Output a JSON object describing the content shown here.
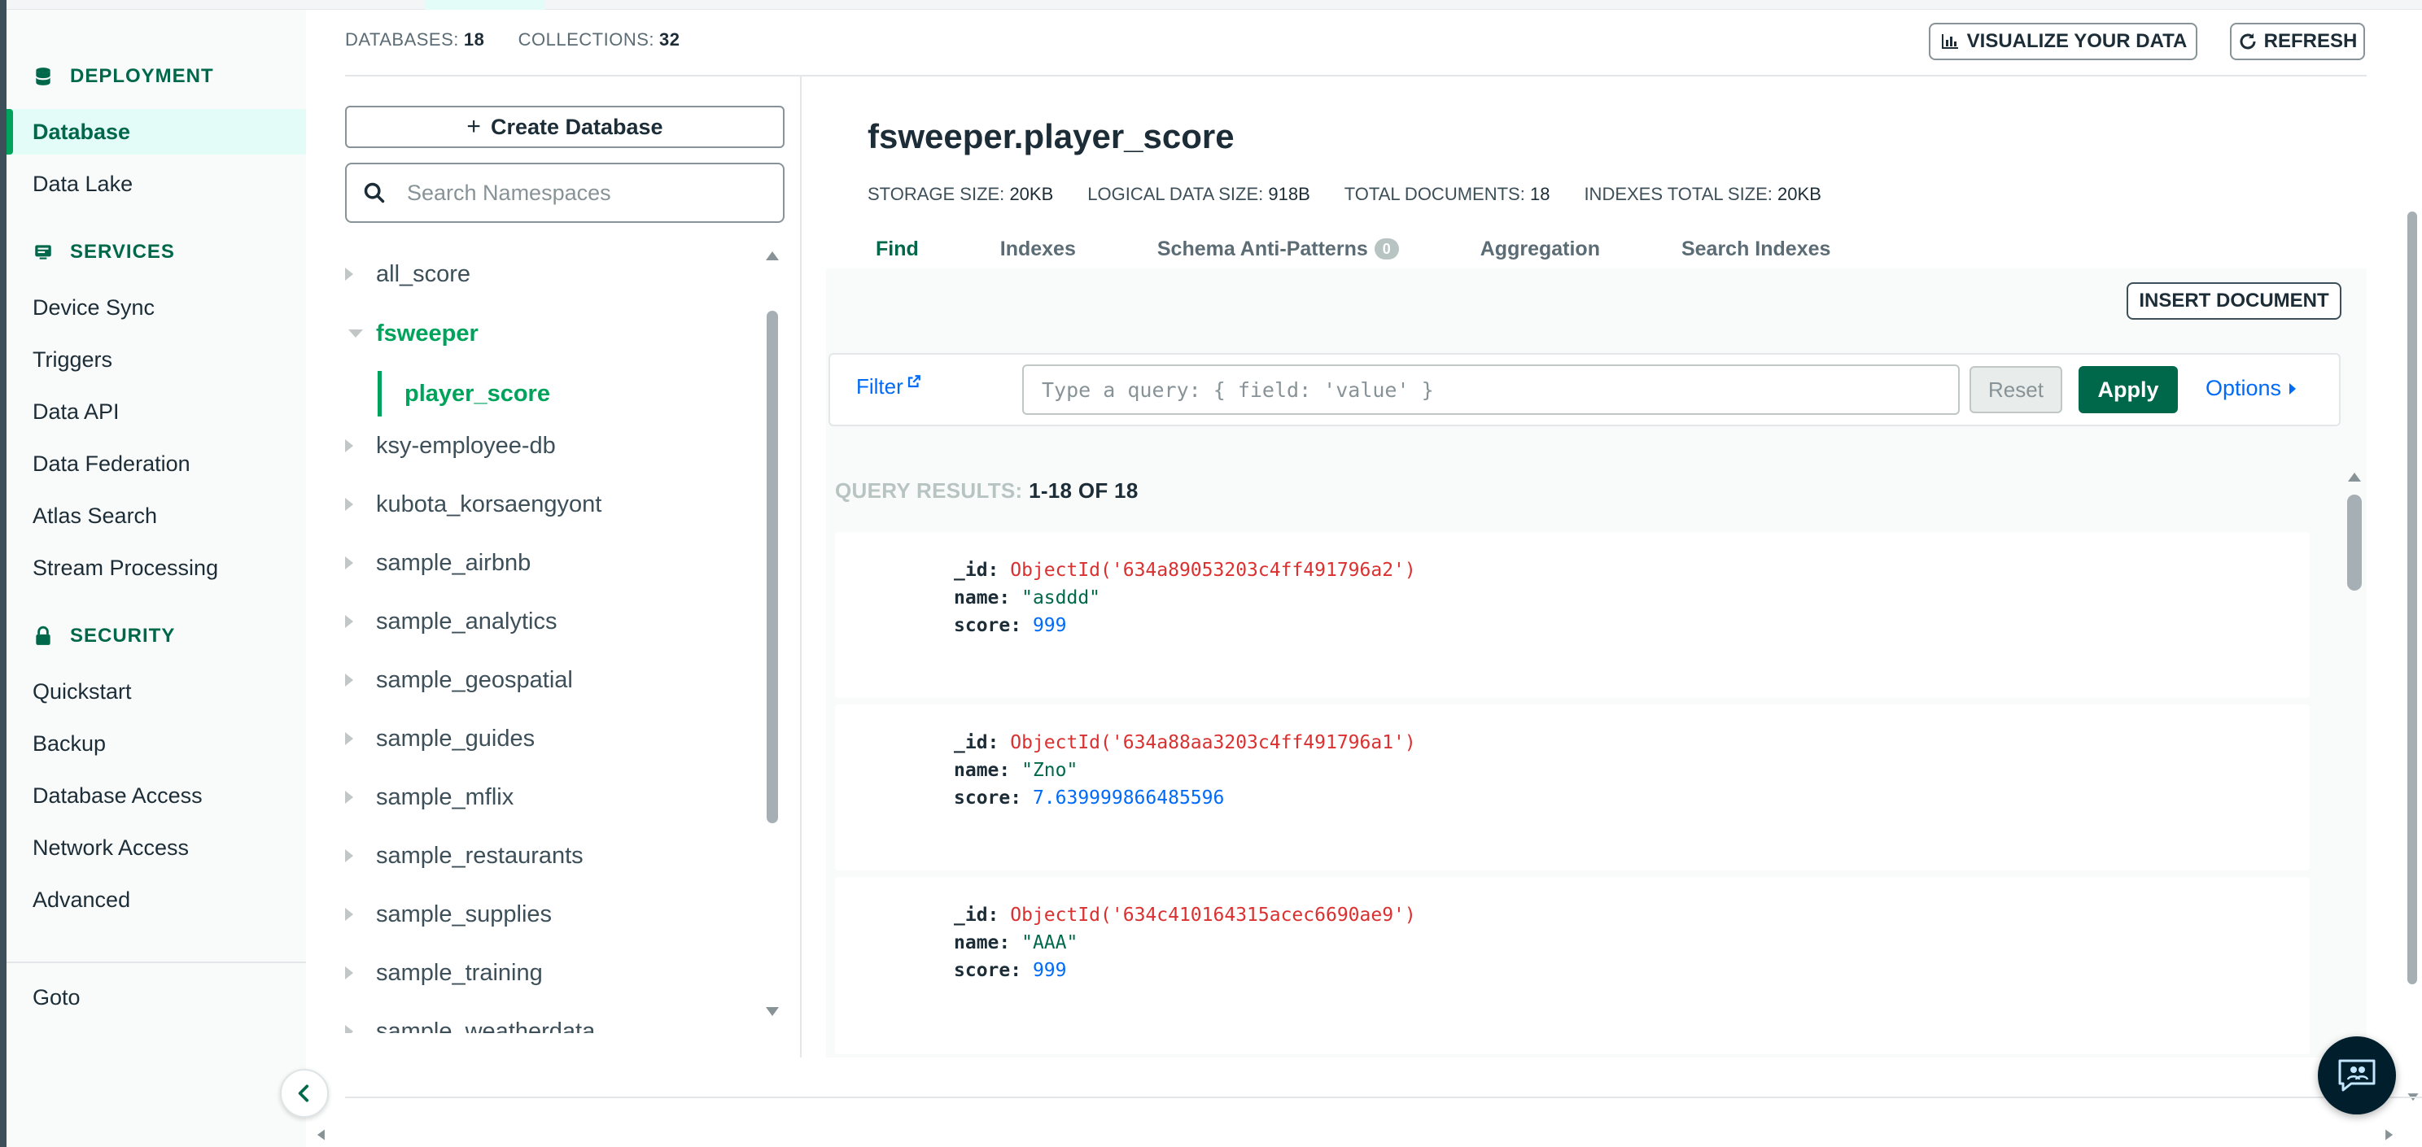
{
  "header": {
    "databases_label": "DATABASES:",
    "databases_count": "18",
    "collections_label": "COLLECTIONS:",
    "collections_count": "32",
    "visualize_label": "VISUALIZE YOUR DATA",
    "refresh_label": "REFRESH"
  },
  "sidebar": {
    "sections": [
      {
        "title": "DEPLOYMENT",
        "icon": "database-icon",
        "items": [
          "Database",
          "Data Lake"
        ]
      },
      {
        "title": "SERVICES",
        "icon": "services-icon",
        "items": [
          "Device Sync",
          "Triggers",
          "Data API",
          "Data Federation",
          "Atlas Search",
          "Stream Processing"
        ]
      },
      {
        "title": "SECURITY",
        "icon": "lock-icon",
        "items": [
          "Quickstart",
          "Backup",
          "Database Access",
          "Network Access",
          "Advanced"
        ]
      }
    ],
    "active_item": "Database",
    "goto_label": "Goto"
  },
  "namespaces": {
    "create_label": "Create Database",
    "search_placeholder": "Search Namespaces",
    "items": [
      "all_score",
      "fsweeper",
      "ksy-employee-db",
      "kubota_korsaengyont",
      "sample_airbnb",
      "sample_analytics",
      "sample_geospatial",
      "sample_guides",
      "sample_mflix",
      "sample_restaurants",
      "sample_supplies",
      "sample_training",
      "sample_weatherdata"
    ],
    "open_db": "fsweeper",
    "open_collection": "player_score"
  },
  "collection": {
    "title": "fsweeper.player_score",
    "stats": [
      {
        "label": "STORAGE SIZE:",
        "value": "20KB"
      },
      {
        "label": "LOGICAL DATA SIZE:",
        "value": "918B"
      },
      {
        "label": "TOTAL DOCUMENTS:",
        "value": "18"
      },
      {
        "label": "INDEXES TOTAL SIZE:",
        "value": "20KB"
      }
    ],
    "tabs": [
      "Find",
      "Indexes",
      "Schema Anti-Patterns",
      "Aggregation",
      "Search Indexes"
    ],
    "active_tab": "Find",
    "anti_patterns_count": "0",
    "insert_label": "INSERT DOCUMENT"
  },
  "filter": {
    "label": "Filter",
    "placeholder": "Type a query: { field: 'value' }",
    "reset_label": "Reset",
    "apply_label": "Apply",
    "options_label": "Options"
  },
  "results": {
    "label": "QUERY RESULTS:",
    "range": "1-18 OF 18",
    "documents": [
      {
        "id": "ObjectId('634a89053203c4ff491796a2')",
        "name": "\"asddd\"",
        "score": "999"
      },
      {
        "id": "ObjectId('634a88aa3203c4ff491796a1')",
        "name": "\"Zno\"",
        "score": "7.639999866485596"
      },
      {
        "id": "ObjectId('634c410164315acec6690ae9')",
        "name": "\"AAA\"",
        "score": "999"
      }
    ]
  }
}
